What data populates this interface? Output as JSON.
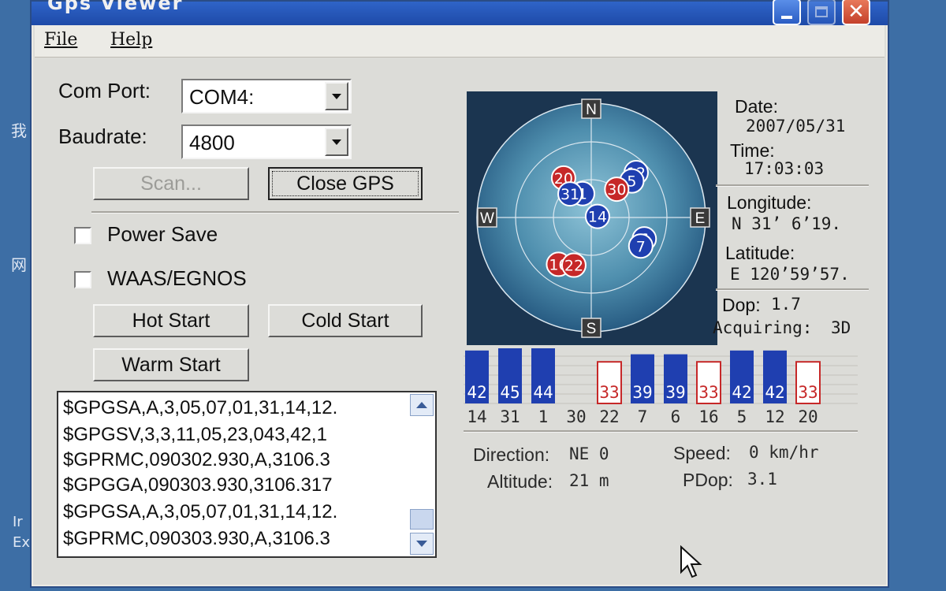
{
  "window": {
    "title": "Gps Viewer"
  },
  "titlebar": {
    "minimize_icon": "minimize-icon",
    "maximize_icon": "maximize-icon",
    "close_icon": "close-icon"
  },
  "menu": {
    "file_label": "File",
    "help_label": "Help"
  },
  "settings": {
    "com_port_label": "Com Port:",
    "com_port_value": "COM4:",
    "baudrate_label": "Baudrate:",
    "baudrate_value": "4800",
    "scan_label": "Scan...",
    "close_gps_label": "Close GPS",
    "power_save_label": "Power Save",
    "power_save_checked": false,
    "waas_label": "WAAS/EGNOS",
    "waas_checked": false,
    "hot_start_label": "Hot Start",
    "cold_start_label": "Cold Start",
    "warm_start_label": "Warm Start"
  },
  "nmea_log": [
    "$GPGSA,A,3,05,07,01,31,14,12.",
    "$GPGSV,3,3,11,05,23,043,42,1",
    "$GPRMC,090302.930,A,3106.3",
    "$GPGGA,090303.930,3106.317",
    "$GPGSA,A,3,05,07,01,31,14,12.",
    "$GPRMC,090303.930,A,3106.3"
  ],
  "skyview": {
    "compass": {
      "n": "N",
      "s": "S",
      "e": "E",
      "w": "W"
    },
    "satellites": [
      {
        "id": "20",
        "state": "searching",
        "az": 325,
        "el": 52
      },
      {
        "id": "12",
        "state": "tracking",
        "az": 45,
        "el": 40
      },
      {
        "id": "5",
        "state": "tracking",
        "az": 48,
        "el": 47
      },
      {
        "id": "30",
        "state": "searching",
        "az": 42,
        "el": 60
      },
      {
        "id": "1",
        "state": "tracking",
        "az": 340,
        "el": 70
      },
      {
        "id": "31",
        "state": "tracking",
        "az": 318,
        "el": 65
      },
      {
        "id": "14",
        "state": "tracking",
        "az": 80,
        "el": 85
      },
      {
        "id": "6",
        "state": "tracking",
        "az": 112,
        "el": 45
      },
      {
        "id": "7",
        "state": "tracking",
        "az": 120,
        "el": 45
      },
      {
        "id": "16",
        "state": "searching",
        "az": 215,
        "el": 45
      },
      {
        "id": "22",
        "state": "searching",
        "az": 200,
        "el": 50
      }
    ],
    "colors": {
      "tracking": "#1f3fb0",
      "searching": "#c62828"
    }
  },
  "info": {
    "date_label": "Date:",
    "date_value": "2007/05/31",
    "time_label": "Time:",
    "time_value": "17:03:03",
    "longitude_label": "Longitude:",
    "longitude_value": "N  31’ 6’19.",
    "latitude_label": "Latitude:",
    "latitude_value": "E 120’59’57.",
    "dop_label": "Dop:",
    "dop_value": "1.7",
    "acquiring_label": "Acquiring:",
    "acquiring_value": "3D"
  },
  "signal_bars": [
    {
      "sat": "14",
      "snr": "42",
      "tracked": true
    },
    {
      "sat": "31",
      "snr": "45",
      "tracked": true
    },
    {
      "sat": "1",
      "snr": "44",
      "tracked": true
    },
    {
      "sat": "30",
      "snr": "",
      "tracked": false
    },
    {
      "sat": "22",
      "snr": "33",
      "tracked": false
    },
    {
      "sat": "7",
      "snr": "39",
      "tracked": true
    },
    {
      "sat": "6",
      "snr": "39",
      "tracked": true
    },
    {
      "sat": "16",
      "snr": "33",
      "tracked": false
    },
    {
      "sat": "5",
      "snr": "42",
      "tracked": true
    },
    {
      "sat": "12",
      "snr": "42",
      "tracked": true
    },
    {
      "sat": "20",
      "snr": "33",
      "tracked": false
    }
  ],
  "motion": {
    "direction_label": "Direction:",
    "direction_value": "NE 0",
    "speed_label": "Speed:",
    "speed_value": "0 km/hr",
    "altitude_label": "Altitude:",
    "altitude_value": "21 m",
    "pdop_label": "PDop:",
    "pdop_value": "3.1"
  },
  "desktop": {
    "glyph_1": "我",
    "glyph_2": "网",
    "text_1": "Ir",
    "text_2": "Ex"
  }
}
